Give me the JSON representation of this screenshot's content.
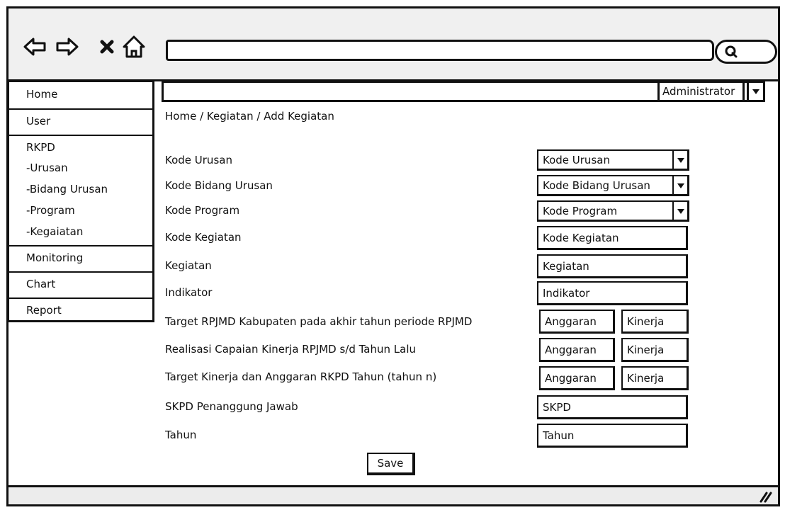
{
  "sidebar": {
    "items": [
      {
        "label": "Home"
      },
      {
        "label": "User"
      },
      {
        "label": "RKPD"
      },
      {
        "label": "-Urusan"
      },
      {
        "label": "-Bidang Urusan"
      },
      {
        "label": "-Program"
      },
      {
        "label": "-Kegaiatan"
      },
      {
        "label": "Monitoring"
      },
      {
        "label": "Chart"
      },
      {
        "label": "Report"
      }
    ]
  },
  "header": {
    "user_select": "Administrator",
    "breadcrumb": "Home / Kegiatan /  Add Kegiatan"
  },
  "form": {
    "labels": {
      "kode_urusan": "Kode Urusan",
      "kode_bidang_urusan": "Kode Bidang Urusan",
      "kode_program": "Kode Program",
      "kode_kegiatan": "Kode Kegiatan",
      "kegiatan": "Kegiatan",
      "indikator": "Indikator",
      "target_rpjmd": "Target RPJMD Kabupaten pada akhir tahun periode RPJMD",
      "realisasi": "Realisasi Capaian Kinerja RPJMD s/d Tahun Lalu",
      "target_kinerja": "Target Kinerja dan Anggaran RKPD Tahun (tahun n)",
      "skpd": "SKPD Penanggung Jawab",
      "tahun": "Tahun"
    },
    "fields": {
      "kode_urusan": "Kode Urusan",
      "kode_bidang_urusan": "Kode Bidang Urusan",
      "kode_program": "Kode Program",
      "kode_kegiatan": "Kode Kegiatan",
      "kegiatan": "Kegiatan",
      "indikator": "Indikator",
      "anggaran": "Anggaran",
      "kinerja": "Kinerja",
      "skpd": "SKPD",
      "tahun": "Tahun"
    },
    "save_label": "Save"
  },
  "icons": {
    "back": "arrow-left-icon",
    "forward": "arrow-right-icon",
    "stop": "close-icon",
    "home": "home-icon",
    "search": "search-icon",
    "dropdown": "triangle-down-icon",
    "resize": "resize-grip-icon"
  }
}
